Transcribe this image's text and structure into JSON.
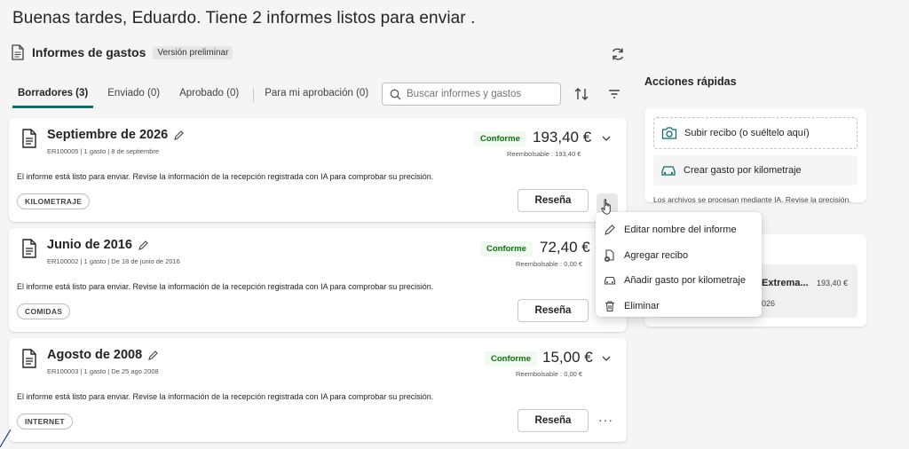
{
  "greeting": "Buenas tardes, Eduardo. Tiene 2 informes listos para enviar .",
  "section": {
    "title": "Informes de gastos",
    "badge": "Versión preliminar",
    "refresh_icon": "refresh-icon",
    "doc_icon": "document-icon"
  },
  "tabs": [
    {
      "label": "Borradores (3)",
      "active": true
    },
    {
      "label": "Enviado (0)"
    },
    {
      "label": "Aprobado (0)"
    },
    {
      "label": "Para mi aprobación (0)"
    }
  ],
  "search": {
    "placeholder": "Buscar informes y gastos",
    "icon": "search-icon"
  },
  "toolbar": {
    "sort_icon": "sort-icon",
    "filter_icon": "filter-icon"
  },
  "reports": [
    {
      "title": "Septiembre de 2026",
      "subtitle": "ER100005 | 1 gasto | 8 de septiembre",
      "status": "Conforme",
      "amount": "193,40 €",
      "reimbursable": "Reembolsable : 193,40 €",
      "message": "El informe está listo para enviar. Revise la información de la recepción registrada con IA para comprobar su precisión.",
      "tag": "KILOMETRAJE",
      "action": "Reseña",
      "more": "···"
    },
    {
      "title": "Junio de 2016",
      "subtitle": "ER100002 | 1 gasto | De 18 de junio de 2016",
      "status": "Conforme",
      "amount": "72,40 €",
      "reimbursable": "Reembolsable : 0,00 €",
      "message": "El informe está listo para enviar. Revise la información de la recepción registrada con IA para comprobar su precisión.",
      "tag": "COMIDAS",
      "action": "Reseña",
      "more": "···"
    },
    {
      "title": "Agosto de 2008",
      "subtitle": "ER100003 | 1 gasto | De 25 ago 2008",
      "status": "Conforme",
      "amount": "15,00 €",
      "reimbursable": "Reembolsable : 0,00 €",
      "message": "El informe está listo para enviar. Revise la información de la recepción registrada con IA para comprobar su precisión.",
      "tag": "INTERNET",
      "action": "Reseña",
      "more": "···"
    }
  ],
  "context_menu": [
    {
      "label": "Editar nombre del informe",
      "icon": "pencil-icon"
    },
    {
      "label": "Agregar recibo",
      "icon": "add-receipt-icon"
    },
    {
      "label": "Añadir gasto por kilometraje",
      "icon": "car-icon"
    },
    {
      "label": "Eliminar",
      "icon": "trash-icon"
    }
  ],
  "quick_actions": {
    "title": "Acciones rápidas",
    "upload": "Subir recibo (o suéltelo aquí)",
    "mileage": "Crear gasto por kilometraje",
    "note": "Los archivos se procesan mediante IA. Revise la precisión."
  },
  "recent": {
    "name": "Extrema...",
    "amount": "193,40 €",
    "date": "026"
  },
  "colors": {
    "accent": "#106b6b",
    "status_green": "#0e700e",
    "status_bg": "#f1faf1"
  }
}
